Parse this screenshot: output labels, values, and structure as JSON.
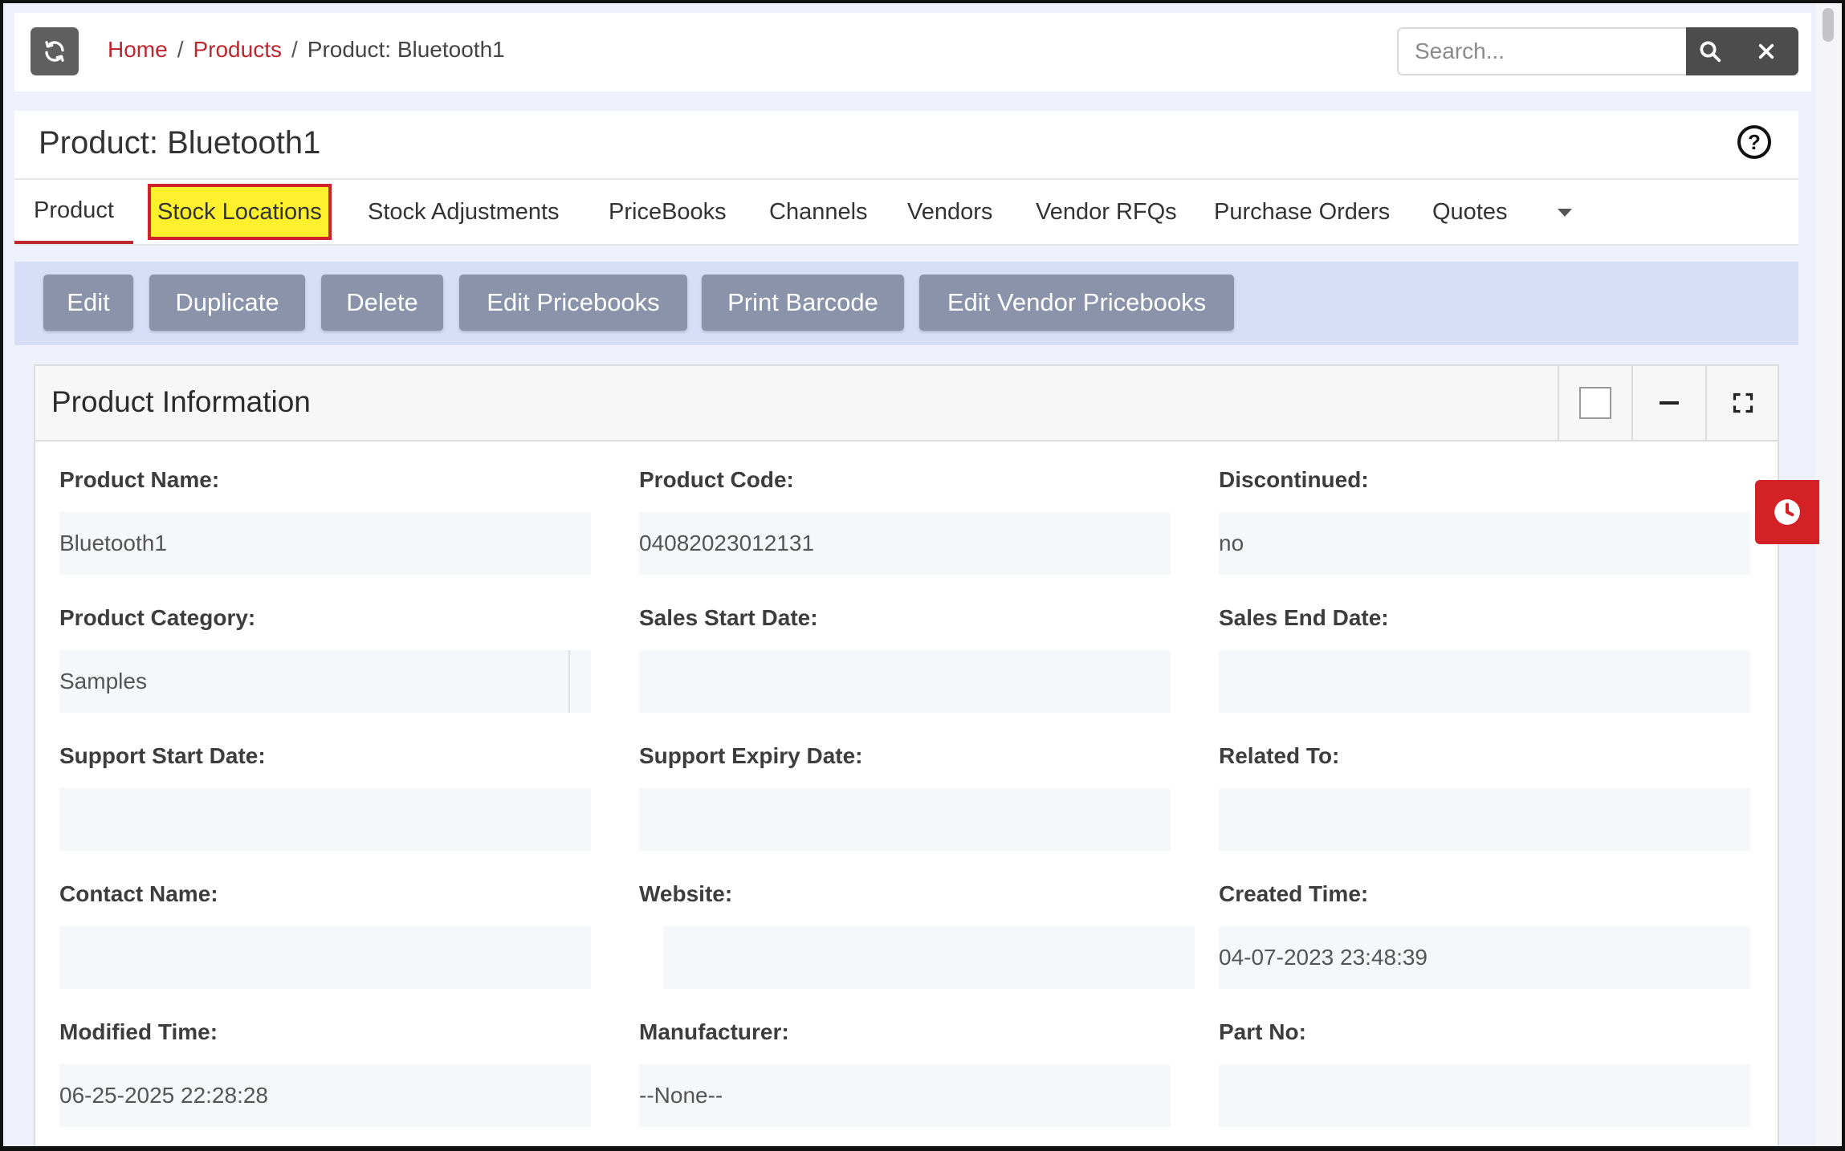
{
  "breadcrumb": {
    "home": "Home",
    "products": "Products",
    "current": "Product: Bluetooth1",
    "separator": "/"
  },
  "search": {
    "placeholder": "Search...",
    "value": ""
  },
  "page": {
    "title": "Product: Bluetooth1",
    "help_symbol": "?"
  },
  "tabs": [
    {
      "label": "Product"
    },
    {
      "label": "Stock Locations"
    },
    {
      "label": "Stock Adjustments"
    },
    {
      "label": "PriceBooks"
    },
    {
      "label": "Channels"
    },
    {
      "label": "Vendors"
    },
    {
      "label": "Vendor RFQs"
    },
    {
      "label": "Purchase Orders"
    },
    {
      "label": "Quotes"
    }
  ],
  "actions": {
    "edit": "Edit",
    "duplicate": "Duplicate",
    "delete": "Delete",
    "edit_pricebooks": "Edit Pricebooks",
    "print_barcode": "Print Barcode",
    "edit_vendor_pricebooks": "Edit Vendor Pricebooks"
  },
  "panel": {
    "title": "Product Information"
  },
  "fields": {
    "product_name": {
      "label": "Product Name:",
      "value": "Bluetooth1"
    },
    "product_code": {
      "label": "Product Code:",
      "value": "04082023012131"
    },
    "discontinued": {
      "label": "Discontinued:",
      "value": "no"
    },
    "product_category": {
      "label": "Product Category:",
      "value": "Samples"
    },
    "sales_start_date": {
      "label": "Sales Start Date:",
      "value": ""
    },
    "sales_end_date": {
      "label": "Sales End Date:",
      "value": ""
    },
    "support_start_date": {
      "label": "Support Start Date:",
      "value": ""
    },
    "support_expiry_date": {
      "label": "Support Expiry Date:",
      "value": ""
    },
    "related_to": {
      "label": "Related To:",
      "value": ""
    },
    "contact_name": {
      "label": "Contact Name:",
      "value": ""
    },
    "website": {
      "label": "Website:",
      "value": ""
    },
    "created_time": {
      "label": "Created Time:",
      "value": "04-07-2023 23:48:39"
    },
    "modified_time": {
      "label": "Modified Time:",
      "value": "06-25-2025 22:28:28"
    },
    "manufacturer": {
      "label": "Manufacturer:",
      "value": "--None--"
    },
    "part_no": {
      "label": "Part No:",
      "value": ""
    }
  },
  "icons": {
    "refresh": "refresh-icon",
    "search": "search-icon",
    "close": "close-icon",
    "help": "help-icon",
    "more": "caret-down-icon",
    "minimize": "minus-icon",
    "fullscreen": "expand-icon",
    "clock": "clock-icon"
  },
  "colors": {
    "accent": "#c0262d",
    "action_button": "#8a93aa",
    "action_bar": "#d7ddf6",
    "highlight_fill": "#fff02e",
    "clock_tab": "#d42126"
  }
}
